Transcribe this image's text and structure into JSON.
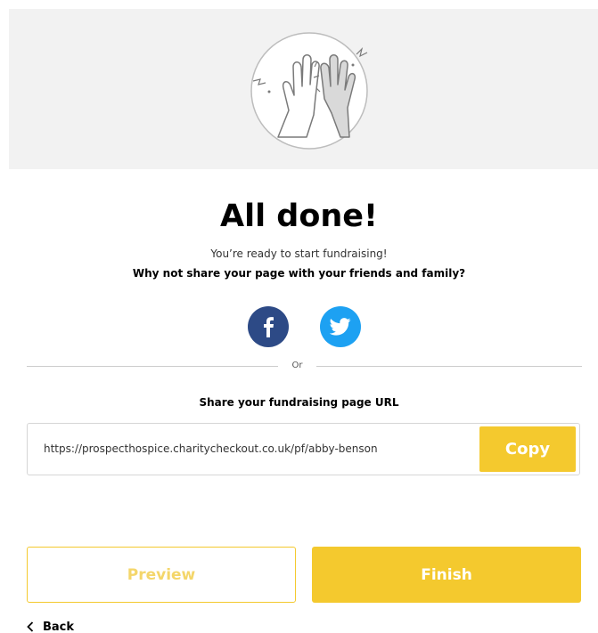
{
  "hero": {
    "illustration_icon": "high-five-icon"
  },
  "heading": {
    "title": "All done!",
    "subtitle": "You’re ready to start fundraising!",
    "share_prompt": "Why not share your page with your friends and family?"
  },
  "social": {
    "facebook_icon": "facebook-icon",
    "twitter_icon": "twitter-icon",
    "colors": {
      "facebook": "#2d4a86",
      "twitter": "#1da1f2"
    }
  },
  "divider": {
    "label": "Or"
  },
  "share_url": {
    "label": "Share your fundraising page URL",
    "value": "https://prospecthospice.charitycheckout.co.uk/pf/abby-benson",
    "copy_label": "Copy"
  },
  "actions": {
    "preview_label": "Preview",
    "finish_label": "Finish",
    "back_label": "Back",
    "back_icon": "chevron-left-icon"
  },
  "colors": {
    "accent": "#f4c92e",
    "hero_background": "#f2f2f2"
  }
}
